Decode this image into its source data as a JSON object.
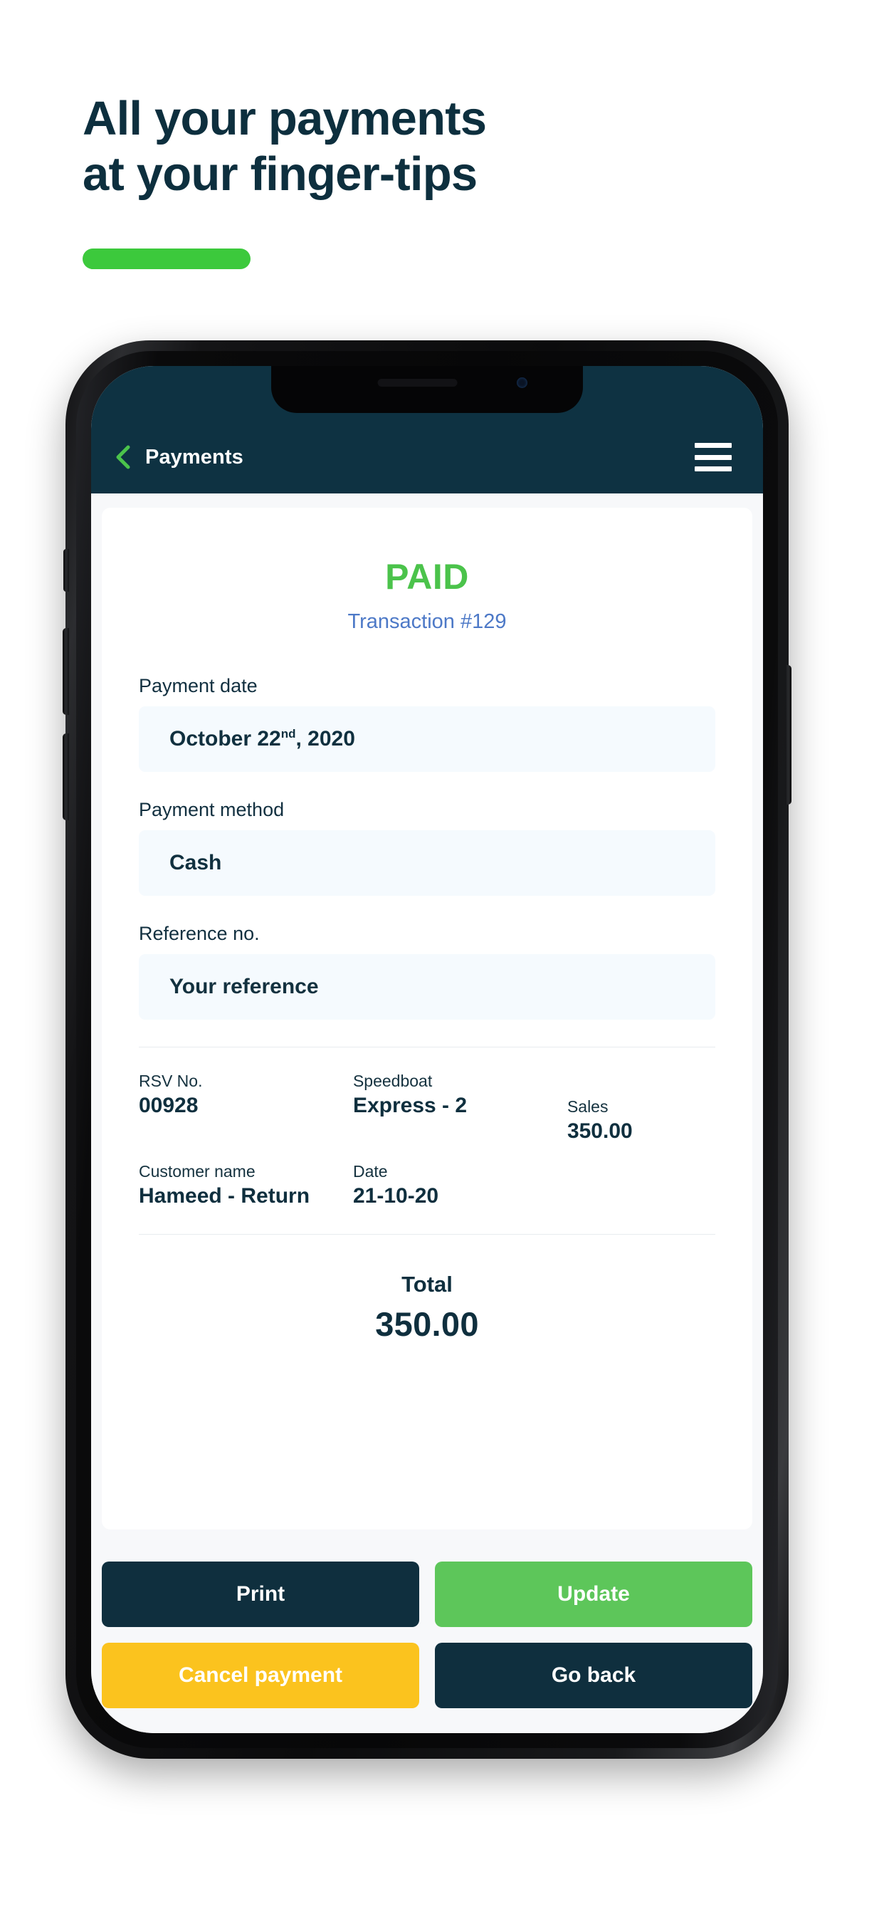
{
  "marketing": {
    "headline_line1": "All your payments",
    "headline_line2": "at your finger-tips",
    "accent_color": "#3CC93C"
  },
  "app": {
    "header": {
      "back_icon": "chevron-left-icon",
      "title": "Payments",
      "menu_icon": "hamburger-menu-icon",
      "background_color": "#0E3242",
      "back_icon_color": "#4BC34B"
    },
    "status": {
      "label": "PAID",
      "label_color": "#4BC34B",
      "transaction": "Transaction #129",
      "transaction_color": "#4D79C7"
    },
    "fields": [
      {
        "label": "Payment date",
        "value": "October 22",
        "value_sup": "nd",
        "value_tail": ", 2020",
        "name": "payment-date"
      },
      {
        "label": "Payment method",
        "value": "Cash",
        "name": "payment-method"
      },
      {
        "label": "Reference no.",
        "value": "Your reference",
        "name": "reference-no"
      }
    ],
    "details": {
      "rsv_no_label": "RSV No.",
      "rsv_no_value": "00928",
      "speedboat_label": "Speedboat",
      "speedboat_value": "Express - 2",
      "sales_label": "Sales",
      "sales_value": "350.00",
      "customer_label": "Customer name",
      "customer_value": "Hameed - Return",
      "date_label": "Date",
      "date_value": "21-10-20"
    },
    "total": {
      "label": "Total",
      "value": "350.00"
    },
    "actions": [
      {
        "label": "Print",
        "name": "print-button",
        "color": "#0F2F3E"
      },
      {
        "label": "Update",
        "name": "update-button",
        "color": "#5DC65A"
      },
      {
        "label": "Cancel payment",
        "name": "cancel-payment-button",
        "color": "#FBC31E"
      },
      {
        "label": "Go back",
        "name": "go-back-button",
        "color": "#0F2F3E"
      }
    ]
  }
}
